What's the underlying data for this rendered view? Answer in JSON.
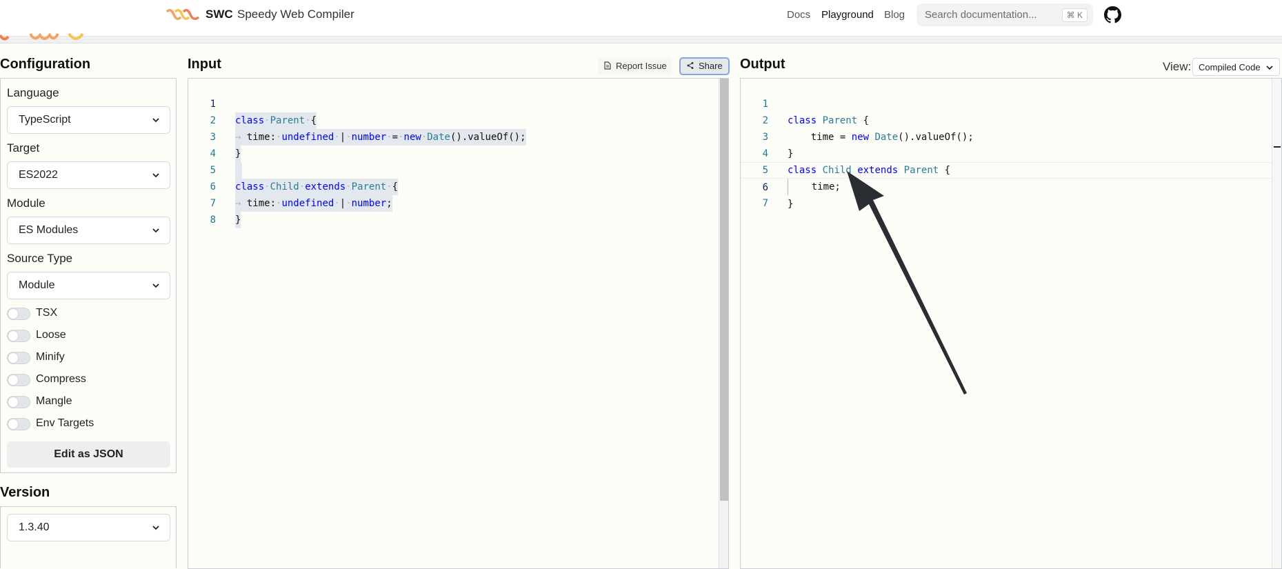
{
  "header": {
    "brand": "SWC",
    "brand_subtitle": "Speedy Web Compiler",
    "nav": {
      "docs": "Docs",
      "playground": "Playground",
      "blog": "Blog"
    },
    "search": {
      "placeholder": "Search documentation...",
      "shortcut": "⌘ K"
    }
  },
  "config": {
    "title": "Configuration",
    "language": {
      "label": "Language",
      "value": "TypeScript"
    },
    "target": {
      "label": "Target",
      "value": "ES2022"
    },
    "module": {
      "label": "Module",
      "value": "ES Modules"
    },
    "source_type": {
      "label": "Source Type",
      "value": "Module"
    },
    "toggles": [
      {
        "label": "TSX",
        "on": false
      },
      {
        "label": "Loose",
        "on": false
      },
      {
        "label": "Minify",
        "on": false
      },
      {
        "label": "Compress",
        "on": false
      },
      {
        "label": "Mangle",
        "on": false
      },
      {
        "label": "Env Targets",
        "on": false
      }
    ],
    "edit_json": "Edit as JSON"
  },
  "version": {
    "title": "Version",
    "value": "1.3.40"
  },
  "input": {
    "title": "Input",
    "report_issue": "Report Issue",
    "share": "Share",
    "line_numbers": [
      "1",
      "2",
      "3",
      "4",
      "5",
      "6",
      "7",
      "8"
    ]
  },
  "output": {
    "title": "Output",
    "view_label": "View:",
    "view_value": "Compiled Code",
    "line_numbers": [
      "1",
      "2",
      "3",
      "4",
      "5",
      "6",
      "7"
    ]
  },
  "colors": {
    "keyword": "#0000ff",
    "type": "#267f99",
    "line_number": "#237893",
    "share_border": "#7fa8e8"
  }
}
